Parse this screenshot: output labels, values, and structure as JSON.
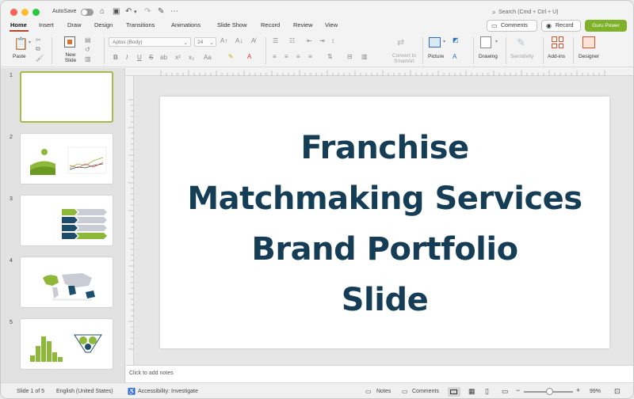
{
  "titlebar": {
    "autosave_label": "AutoSave",
    "search_placeholder": "Search (Cmd + Ctrl + U)",
    "icons": [
      "home-icon",
      "save-icon",
      "undo-icon",
      "redo-icon",
      "customize-icon",
      "more-icon"
    ]
  },
  "menu": {
    "tabs": [
      "Home",
      "Insert",
      "Draw",
      "Design",
      "Transitions",
      "Animations",
      "Slide Show",
      "Record",
      "Review",
      "View"
    ],
    "active_tab": "Home",
    "comments_label": "Comments",
    "record_label": "Record",
    "guru_label": "Guru Power"
  },
  "ribbon": {
    "paste_label": "Paste",
    "new_slide_label": "New Slide",
    "font_name": "Aptos (Body)",
    "font_size": "24",
    "convert_label": "Convert to SmartArt",
    "picture_label": "Picture",
    "drawing_label": "Drawing",
    "sensitivity_label": "Sensitivity",
    "addins_label": "Add-ins",
    "designer_label": "Designer",
    "format_buttons": [
      "B",
      "I",
      "U",
      "S",
      "ab",
      "x²",
      "x₂",
      "Aa"
    ]
  },
  "thumbnails": {
    "numbers": [
      "1",
      "2",
      "3",
      "4",
      "5"
    ],
    "selected": 1
  },
  "slide": {
    "title_lines": [
      "Franchise",
      "Matchmaking Services",
      "Brand Portfolio",
      "Slide"
    ],
    "title_color": "#163d56"
  },
  "notes": {
    "placeholder": "Click to add notes"
  },
  "status": {
    "slide_info": "Slide 1 of 5",
    "language": "English (United States)",
    "accessibility": "Accessibility: Investigate",
    "notes_label": "Notes",
    "comments_label": "Comments",
    "zoom": "99%"
  },
  "colors": {
    "accent": "#b5462a",
    "guru": "#7fb22a",
    "thumb_green": "#8db83a",
    "thumb_navy": "#1e4d6b",
    "thumb_gray": "#c9ccd4"
  }
}
